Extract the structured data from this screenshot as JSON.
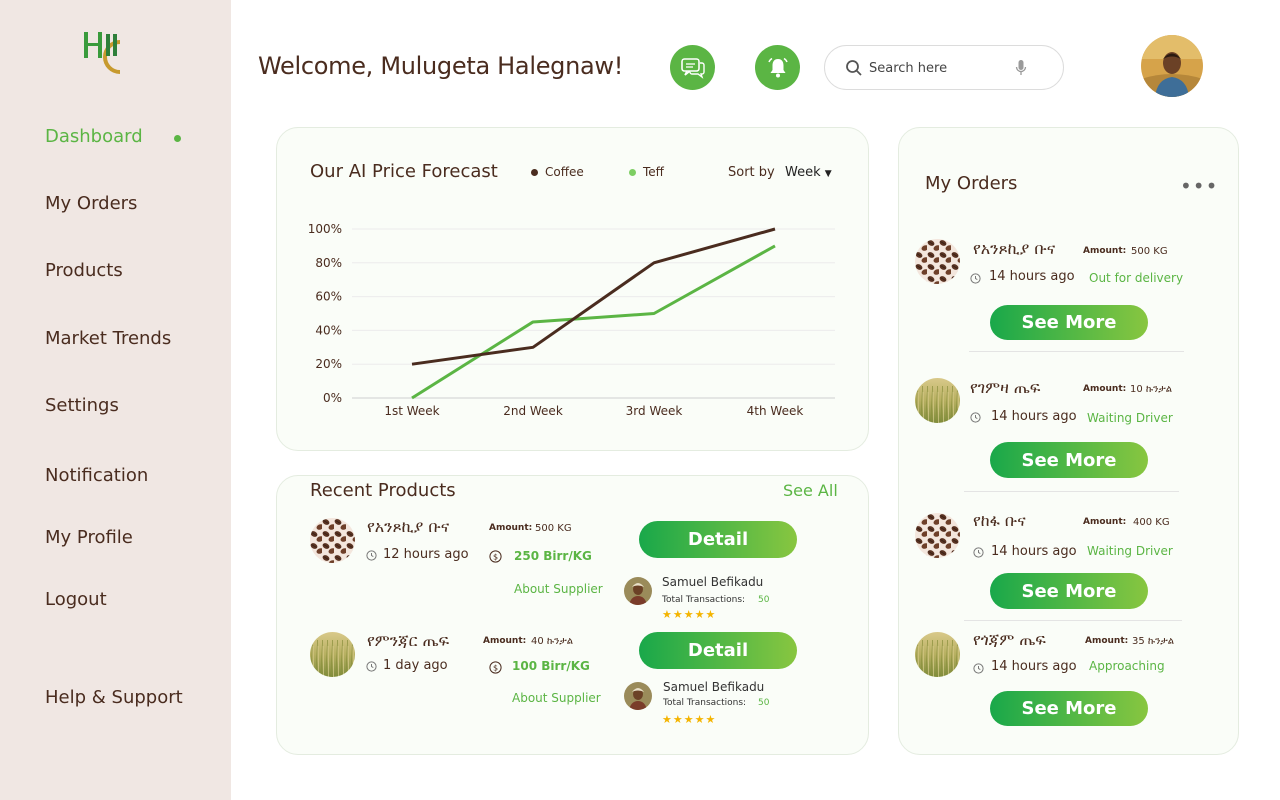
{
  "colors": {
    "accent": "#5bb544",
    "brown": "#4a2c1f",
    "sidebar_bg": "#f0e7e3",
    "card_bg": "#fafdf8"
  },
  "sidebar": {
    "items": [
      {
        "label": "Dashboard",
        "active": true
      },
      {
        "label": "My Orders"
      },
      {
        "label": "Products"
      },
      {
        "label": "Market Trends"
      },
      {
        "label": "Settings"
      },
      {
        "label": "Notification"
      },
      {
        "label": "My Profile"
      },
      {
        "label": "Logout"
      },
      {
        "label": "Help & Support"
      }
    ]
  },
  "header": {
    "welcome": "Welcome, Mulugeta Halegnaw!",
    "search_placeholder": "Search here",
    "icons": [
      "chat-icon",
      "bell-icon",
      "search-icon",
      "mic-icon"
    ]
  },
  "forecast": {
    "title": "Our AI Price Forecast",
    "sort_label": "Sort by",
    "sort_value": "Week",
    "legend": [
      {
        "name": "Coffee",
        "color": "#4a2c1f"
      },
      {
        "name": "Teff",
        "color": "#7dce63"
      }
    ]
  },
  "chart_data": {
    "type": "line",
    "categories": [
      "1st Week",
      "2nd Week",
      "3rd Week",
      "4th Week"
    ],
    "y_ticks": [
      "0%",
      "20%",
      "40%",
      "60%",
      "80%",
      "100%"
    ],
    "ylim": [
      0,
      100
    ],
    "series": [
      {
        "name": "Coffee",
        "color": "#4a2c1f",
        "points": [
          [
            0,
            20
          ],
          [
            1,
            30
          ],
          [
            2,
            80
          ],
          [
            3,
            100
          ]
        ]
      },
      {
        "name": "Teff",
        "color": "#5bb544",
        "points": [
          [
            0,
            0
          ],
          [
            1,
            45
          ],
          [
            2,
            50
          ],
          [
            3,
            90
          ]
        ]
      }
    ]
  },
  "recent": {
    "title": "Recent Products",
    "see_all": "See All",
    "amount_label": "Amount:",
    "detail_label": "Detail",
    "about_label": "About Supplier",
    "tx_label": "Total Transactions:",
    "stars": "★★★★★",
    "items": [
      {
        "name": "የአንጾኪያ ቡና",
        "time": "12 hours ago",
        "amount": "500 KG",
        "price": "250 Birr/KG",
        "supplier": "Samuel Befikadu",
        "transactions": "50"
      },
      {
        "name": "የምንጃር ጤፍ",
        "time": "1 day ago",
        "amount": "40 ኩንታል",
        "price": "100 Birr/KG",
        "supplier": "Samuel Befikadu",
        "transactions": "50"
      }
    ]
  },
  "orders": {
    "title": "My Orders",
    "more": "•••",
    "amount_label": "Amount:",
    "button_label": "See More",
    "items": [
      {
        "name": "የአንጾኪያ ቡና",
        "amount": "500 KG",
        "time": "14 hours ago",
        "status": "Out for delivery",
        "kind": "coffee"
      },
      {
        "name": "የገምዛ ጤፍ",
        "amount": "10 ኩንታል",
        "time": "14 hours ago",
        "status": "Waiting Driver",
        "kind": "teff"
      },
      {
        "name": "የከፋ ቡና",
        "amount": "400 KG",
        "time": "14 hours ago",
        "status": "Waiting Driver",
        "kind": "coffee"
      },
      {
        "name": "የጎጃም ጤፍ",
        "amount": "35 ኩንታል",
        "time": "14 hours ago",
        "status": "Approaching",
        "kind": "teff"
      }
    ]
  }
}
